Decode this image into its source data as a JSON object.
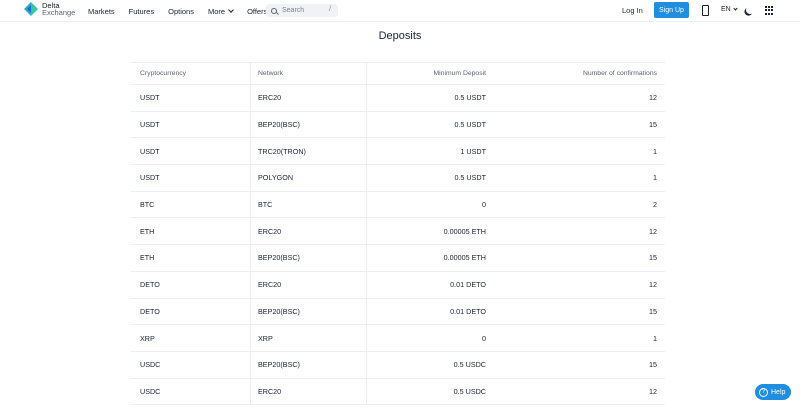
{
  "brand": {
    "name_line1": "Delta",
    "name_line2": "Exchange",
    "accent": "#1f8de0"
  },
  "nav": {
    "items": [
      {
        "label": "Markets"
      },
      {
        "label": "Futures"
      },
      {
        "label": "Options"
      },
      {
        "label": "More"
      },
      {
        "label": "Offers"
      }
    ]
  },
  "search": {
    "placeholder": "Search",
    "shortcut": "/"
  },
  "auth": {
    "login": "Log In",
    "signup": "Sign Up"
  },
  "lang": "EN",
  "page": {
    "title": "Deposits"
  },
  "table": {
    "headers": [
      "Cryptocurrency",
      "Network",
      "Minimum Deposit",
      "Number of confirmations"
    ],
    "rows": [
      [
        "USDT",
        "ERC20",
        "0.5 USDT",
        "12"
      ],
      [
        "USDT",
        "BEP20(BSC)",
        "0.5 USDT",
        "15"
      ],
      [
        "USDT",
        "TRC20(TRON)",
        "1 USDT",
        "1"
      ],
      [
        "USDT",
        "POLYGON",
        "0.5 USDT",
        "1"
      ],
      [
        "BTC",
        "BTC",
        "0",
        "2"
      ],
      [
        "ETH",
        "ERC20",
        "0.00005 ETH",
        "12"
      ],
      [
        "ETH",
        "BEP20(BSC)",
        "0.00005 ETH",
        "15"
      ],
      [
        "DETO",
        "ERC20",
        "0.01 DETO",
        "12"
      ],
      [
        "DETO",
        "BEP20(BSC)",
        "0.01 DETO",
        "15"
      ],
      [
        "XRP",
        "XRP",
        "0",
        "1"
      ],
      [
        "USDC",
        "BEP20(BSC)",
        "0.5 USDC",
        "15"
      ],
      [
        "USDC",
        "ERC20",
        "0.5 USDC",
        "12"
      ]
    ]
  },
  "help": {
    "label": "Help"
  },
  "icons": [
    "logo-icon",
    "chevron-down-icon",
    "search-icon",
    "phone-icon",
    "moon-icon",
    "apps-grid-icon",
    "help-icon"
  ]
}
